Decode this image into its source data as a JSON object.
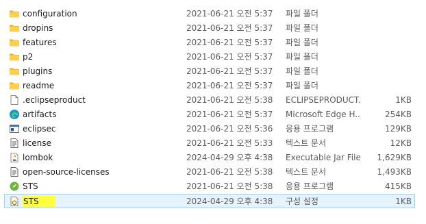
{
  "files": [
    {
      "name": "configuration",
      "date": "2021-06-21 오전 5:37",
      "type": "파일 폴더",
      "size": "",
      "icon": "folder-icon"
    },
    {
      "name": "dropins",
      "date": "2021-06-21 오전 5:37",
      "type": "파일 폴더",
      "size": "",
      "icon": "folder-icon"
    },
    {
      "name": "features",
      "date": "2021-06-21 오전 5:37",
      "type": "파일 폴더",
      "size": "",
      "icon": "folder-icon"
    },
    {
      "name": "p2",
      "date": "2021-06-21 오전 5:37",
      "type": "파일 폴더",
      "size": "",
      "icon": "folder-icon"
    },
    {
      "name": "plugins",
      "date": "2021-06-21 오전 5:37",
      "type": "파일 폴더",
      "size": "",
      "icon": "folder-icon"
    },
    {
      "name": "readme",
      "date": "2021-06-21 오전 5:37",
      "type": "파일 폴더",
      "size": "",
      "icon": "folder-icon"
    },
    {
      "name": ".eclipseproduct",
      "date": "2021-06-21 오전 5:38",
      "type": "ECLIPSEPRODUCT...",
      "size": "1KB",
      "icon": "blank-file-icon"
    },
    {
      "name": "artifacts",
      "date": "2021-06-21 오전 5:37",
      "type": "Microsoft Edge H...",
      "size": "254KB",
      "icon": "edge-icon"
    },
    {
      "name": "eclipsec",
      "date": "2021-06-21 오전 5:36",
      "type": "응용 프로그램",
      "size": "129KB",
      "icon": "console-app-icon"
    },
    {
      "name": "license",
      "date": "2021-06-21 오전 5:33",
      "type": "텍스트 문서",
      "size": "12KB",
      "icon": "text-file-icon"
    },
    {
      "name": "lombok",
      "date": "2024-04-29 오후 4:38",
      "type": "Executable Jar File",
      "size": "1,629KB",
      "icon": "java-jar-icon"
    },
    {
      "name": "open-source-licenses",
      "date": "2021-06-21 오전 5:38",
      "type": "텍스트 문서",
      "size": "1,493KB",
      "icon": "text-file-icon"
    },
    {
      "name": "STS",
      "date": "2021-06-21 오전 5:38",
      "type": "응용 프로그램",
      "size": "415KB",
      "icon": "spring-icon"
    },
    {
      "name": "STS",
      "date": "2024-04-29 오후 4:38",
      "type": "구성 설정",
      "size": "1KB",
      "icon": "settings-file-icon",
      "selected": true,
      "highlight": "#ffff3b"
    }
  ]
}
